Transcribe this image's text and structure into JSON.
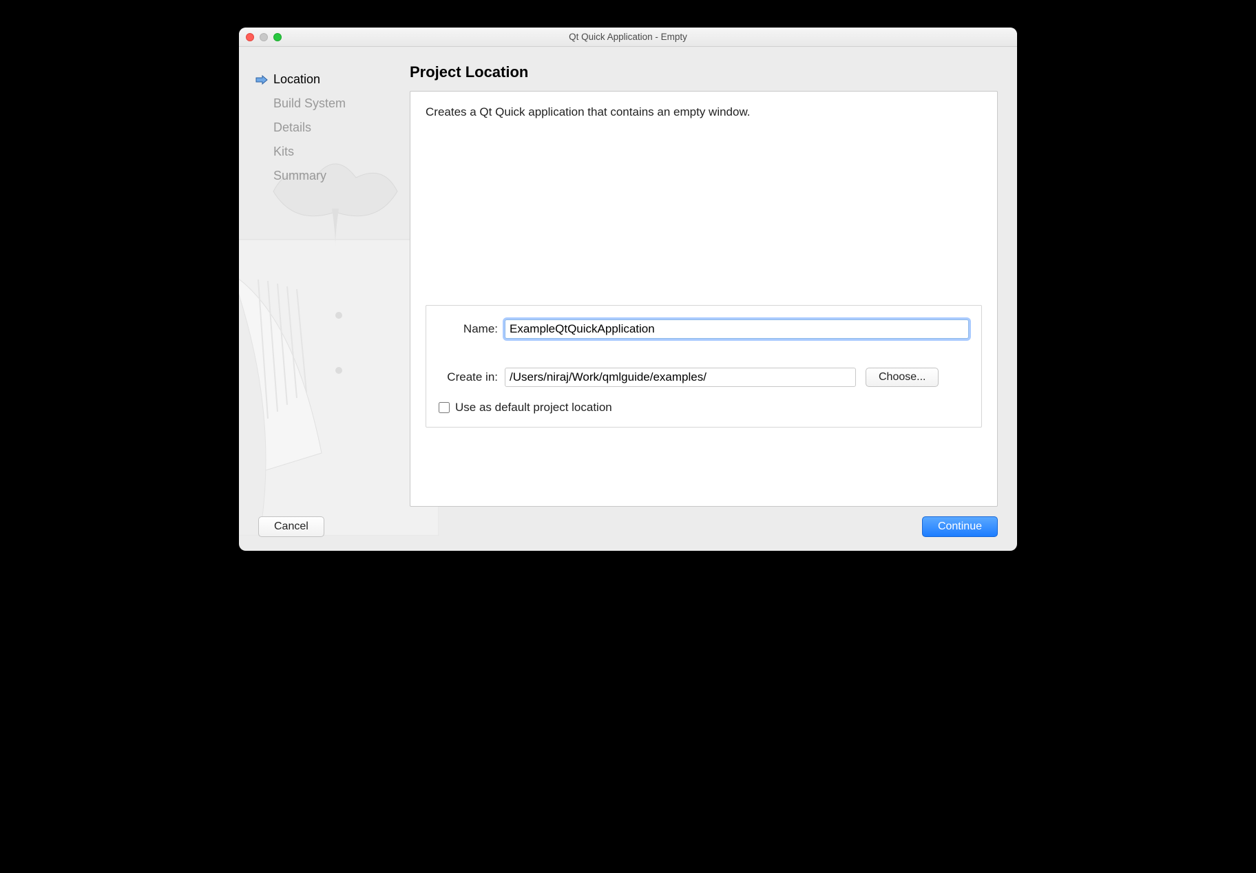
{
  "window": {
    "title": "Qt Quick Application - Empty"
  },
  "sidebar": {
    "steps": [
      {
        "label": "Location",
        "active": true
      },
      {
        "label": "Build System",
        "active": false
      },
      {
        "label": "Details",
        "active": false
      },
      {
        "label": "Kits",
        "active": false
      },
      {
        "label": "Summary",
        "active": false
      }
    ]
  },
  "main": {
    "title": "Project Location",
    "description": "Creates a Qt Quick application that contains an empty window.",
    "name_label": "Name:",
    "name_value": "ExampleQtQuickApplication",
    "createin_label": "Create in:",
    "createin_value": "/Users/niraj/Work/qmlguide/examples/",
    "choose_label": "Choose...",
    "default_checkbox_label": "Use as default project location",
    "default_checkbox_checked": false
  },
  "footer": {
    "cancel_label": "Cancel",
    "continue_label": "Continue"
  }
}
